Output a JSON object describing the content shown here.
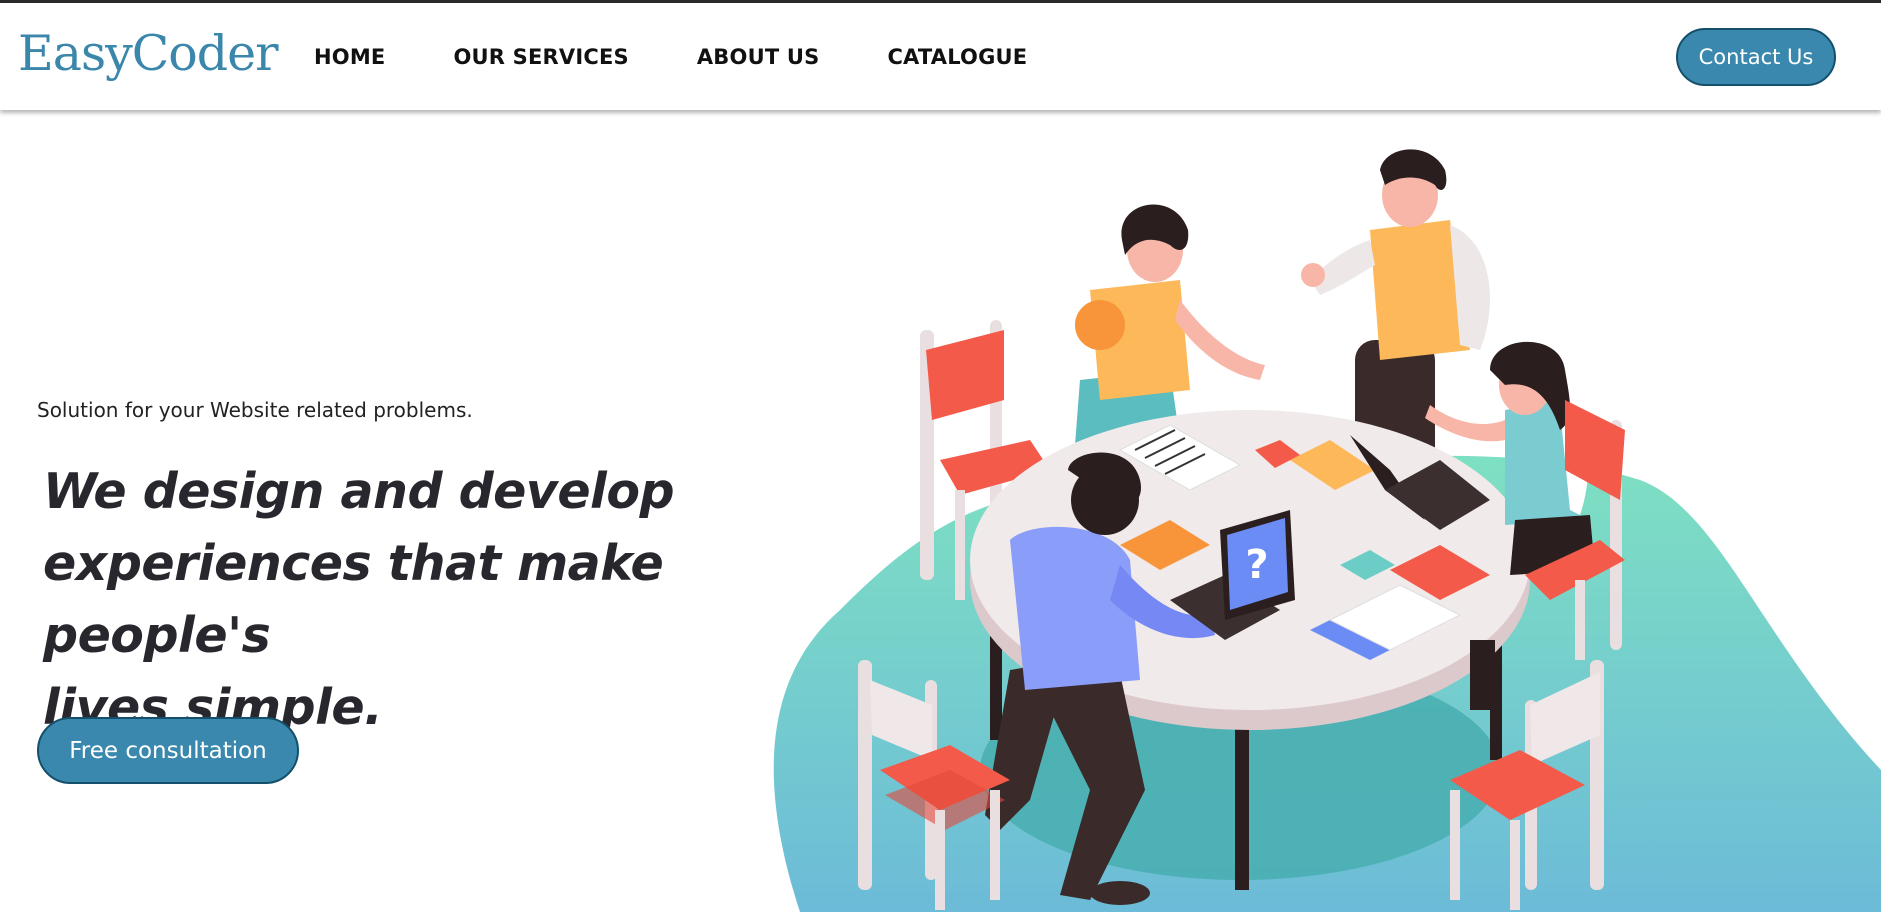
{
  "brand": {
    "logo_text": "EasyCoder"
  },
  "nav": {
    "items": [
      {
        "label": "HOME"
      },
      {
        "label": "OUR SERVICES"
      },
      {
        "label": "ABOUT US"
      },
      {
        "label": "CATALOGUE"
      }
    ],
    "contact_label": "Contact Us"
  },
  "hero": {
    "tagline": "Solution for your Website related problems.",
    "headline_line1": "We design and develop",
    "headline_line2": "experiences that make people's",
    "headline_line3_prefix": "lives ",
    "headline_line3_bold": "simple",
    "headline_line3_suffix": ".",
    "cta_label": "Free consultation"
  },
  "illustration": {
    "question_mark": "?",
    "icons": [
      "team-meeting-illustration",
      "laptop-icon",
      "chair-icon"
    ]
  },
  "colors": {
    "brand": "#3a87ab",
    "button_bg": "#3a88ad",
    "button_border": "#14506b",
    "blob_top": "#79dcc0",
    "blob_bottom": "#6dbfd6",
    "chair_red": "#f35a4a"
  }
}
